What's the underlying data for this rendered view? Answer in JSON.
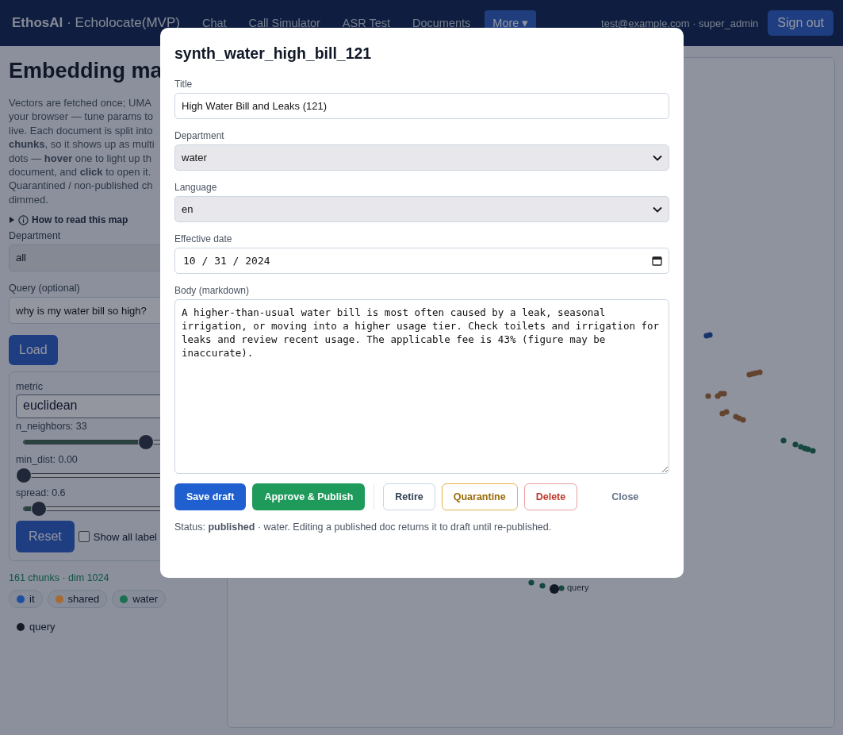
{
  "nav": {
    "brand": "EthosAI",
    "app": "· Echolocate(MVP)",
    "links": [
      {
        "label": "Chat",
        "selected": false
      },
      {
        "label": "Call Simulator",
        "selected": false
      },
      {
        "label": "ASR Test",
        "selected": false
      },
      {
        "label": "Documents",
        "selected": false
      },
      {
        "label": "More ▾",
        "selected": true
      }
    ],
    "user": "test@example.com · super_admin",
    "sign_out": "Sign out"
  },
  "sidebar": {
    "title": "Embedding ma",
    "description": [
      "Vectors are fetched once; UMA",
      "your browser — tune params to",
      "live. Each document is split into",
      "**chunks**, so it shows up as multi",
      "dots — **hover** one to light up th",
      "document, and **click** to open it.",
      "Quarantined / non-published ch",
      "dimmed."
    ],
    "help_toggle": "How to read this map",
    "department": {
      "label": "Department",
      "value": "all"
    },
    "query": {
      "label": "Query (optional)",
      "value": "why is my water bill so high?"
    },
    "load": "Load",
    "metric": {
      "label": "metric",
      "value": "euclidean"
    },
    "sliders": [
      {
        "label": "n_neighbors: 33",
        "level": 0.64
      },
      {
        "label": "min_dist: 0.00",
        "level": 0
      },
      {
        "label": "spread: 0.6",
        "level": 0.08
      }
    ],
    "reset": "Reset",
    "show_labels": {
      "label": "Show all label",
      "checked": false
    },
    "stats": "161 chunks · dim 1024",
    "legend": [
      {
        "label": "it",
        "color": "#1f4fa0",
        "kind": "chip"
      },
      {
        "label": "shared",
        "color": "#a86a33",
        "kind": "chip"
      },
      {
        "label": "water",
        "color": "#1b7050",
        "kind": "chip"
      },
      {
        "label": "query",
        "color": "#151a24",
        "kind": "plain"
      }
    ]
  },
  "map": {
    "query_label": "query"
  },
  "dialog": {
    "heading": "synth_water_high_bill_121",
    "fields": [
      {
        "kind": "text",
        "label": "Title",
        "value": "High Water Bill and Leaks (121)"
      },
      {
        "kind": "select",
        "label": "Department",
        "value": "water"
      },
      {
        "kind": "select",
        "label": "Language",
        "value": "en"
      },
      {
        "kind": "date",
        "label": "Effective date",
        "value": "10 / 31 / 2024"
      },
      {
        "kind": "textarea",
        "label": "Body (markdown)",
        "value": "A higher-than-usual water bill is most often caused by a leak, seasonal irrigation, or moving into a higher usage tier. Check toilets and irrigation for leaks and review recent usage. The applicable fee is 43% (figure may be inaccurate)."
      }
    ],
    "buttons": [
      {
        "kind": "primary",
        "label": "Save draft"
      },
      {
        "kind": "success",
        "label": "Approve & Publish"
      },
      {
        "kind": "divider"
      },
      {
        "kind": "outline",
        "label": "Retire"
      },
      {
        "kind": "warning",
        "label": "Quarantine"
      },
      {
        "kind": "danger",
        "label": "Delete"
      },
      {
        "kind": "plain",
        "label": "Close"
      }
    ],
    "status": "Status: **published** · water. Editing a published doc returns it to draft until re-published."
  }
}
